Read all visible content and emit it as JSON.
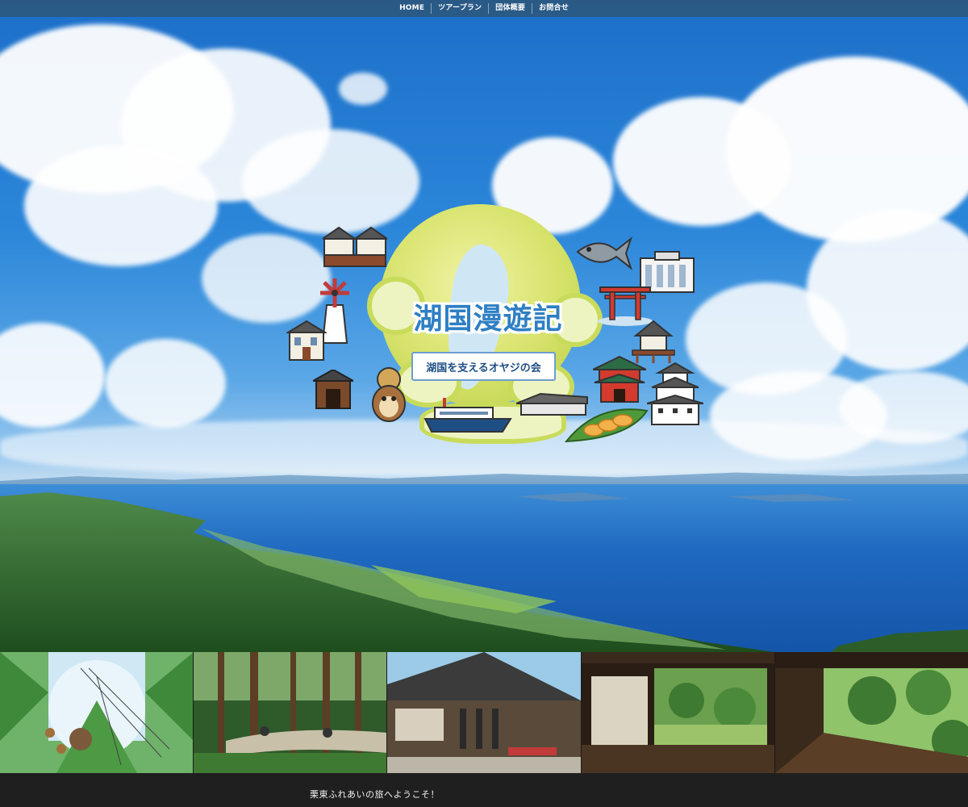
{
  "nav": {
    "items": [
      {
        "label": "HOME"
      },
      {
        "label": "ツアープラン"
      },
      {
        "label": "団体概要"
      },
      {
        "label": "お問合せ"
      }
    ]
  },
  "hero": {
    "logo_title": "湖国漫遊記",
    "logo_subtitle": "湖国を支えるオヤジの会"
  },
  "gallery": {
    "images": [
      {
        "icon": "rope-course-photo"
      },
      {
        "icon": "forest-cycling-photo"
      },
      {
        "icon": "historic-street-photo"
      },
      {
        "icon": "japanese-garden-room-photo"
      },
      {
        "icon": "garden-veranda-photo"
      }
    ]
  },
  "content": {
    "welcome": "栗東ふれあいの旅へようこそ！"
  },
  "colors": {
    "nav_bg": "#2c567c",
    "logo_blue": "#2e7fc4",
    "globe_green": "#d6e26a",
    "page_bg": "#1f1f1f"
  }
}
